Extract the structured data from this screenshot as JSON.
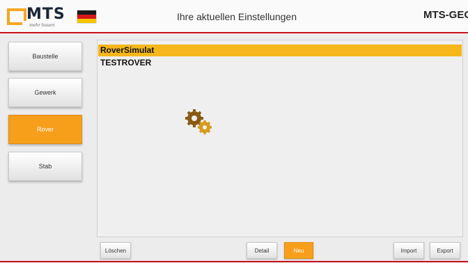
{
  "header": {
    "logo_text": "MTS",
    "logo_subtext": "mehr bauen",
    "title": "Ihre aktuellen Einstellungen",
    "brand": "MTS-GEO",
    "flag_colors": [
      "#1a1a1a",
      "#d6161b",
      "#f3c600"
    ],
    "accent_line_color": "#c9111b"
  },
  "sidebar": {
    "items": [
      {
        "label": "Baustelle",
        "active": false
      },
      {
        "label": "Gewerk",
        "active": false
      },
      {
        "label": "Rover",
        "active": true
      },
      {
        "label": "Stab",
        "active": false
      }
    ]
  },
  "list": {
    "items": [
      {
        "label": "RoverSimulat",
        "selected": true
      },
      {
        "label": "TESTROVER",
        "selected": false
      }
    ],
    "busy_icon": "gears-icon"
  },
  "toolbar": {
    "delete_label": "Löschen",
    "detail_label": "Detail",
    "new_label": "Neu",
    "import_label": "Import",
    "export_label": "Export"
  },
  "colors": {
    "accent": "#f79f1b",
    "selection": "#f5b71a"
  }
}
